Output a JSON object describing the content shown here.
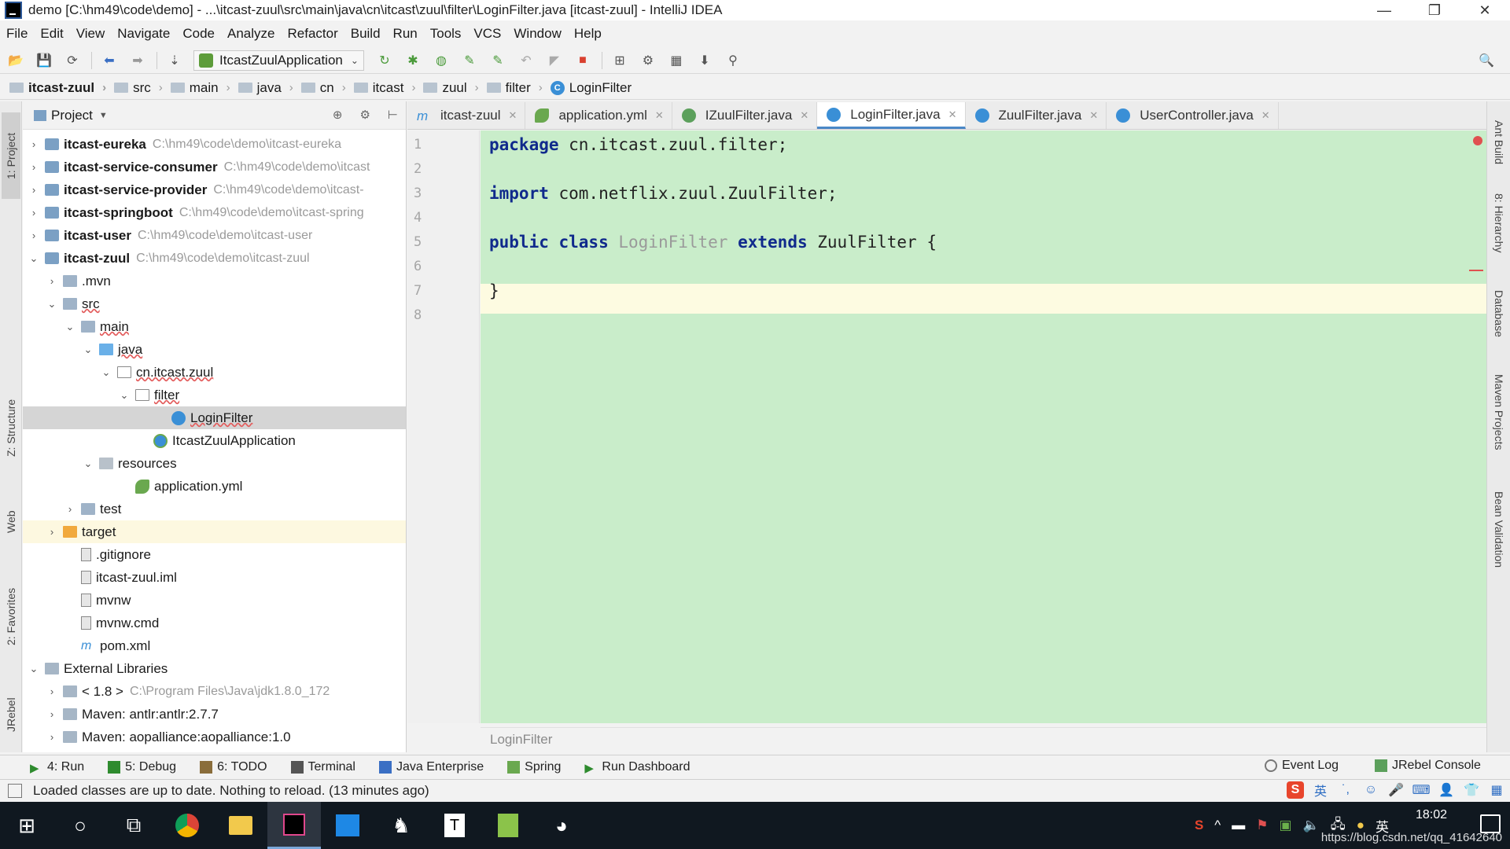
{
  "window": {
    "title": "demo [C:\\hm49\\code\\demo] - ...\\itcast-zuul\\src\\main\\java\\cn\\itcast\\zuul\\filter\\LoginFilter.java [itcast-zuul] - IntelliJ IDEA",
    "minimize": "—",
    "restore": "❐",
    "close": "✕"
  },
  "menu": [
    "File",
    "Edit",
    "View",
    "Navigate",
    "Code",
    "Analyze",
    "Refactor",
    "Build",
    "Run",
    "Tools",
    "VCS",
    "Window",
    "Help"
  ],
  "toolbar": {
    "run_config": "ItcastZuulApplication",
    "icons": [
      "open-icon",
      "save-icon",
      "sync-icon",
      "back-icon",
      "forward-icon",
      "build-icon"
    ],
    "run_icons": [
      "rerun-icon",
      "debug-icon",
      "coverage-icon",
      "profile-icon",
      "attach-icon",
      "reload-icon",
      "stop-icon",
      "stop-red-icon"
    ],
    "misc_icons": [
      "structure-icon",
      "settings-icon",
      "project-structure-icon",
      "sdk-icon",
      "jrebel-icon"
    ],
    "search_icon": "search-icon"
  },
  "breadcrumb": [
    "itcast-zuul",
    "src",
    "main",
    "java",
    "cn",
    "itcast",
    "zuul",
    "filter",
    "LoginFilter"
  ],
  "left_strip": {
    "project_tab": "1: Project",
    "structure_tab": "Z: Structure",
    "web_tab": "Web",
    "favorites_tab": "2: Favorites",
    "jrebel_tab": "JRebel"
  },
  "right_strip": {
    "ant_build": "Ant Build",
    "hierarchy": "8: Hierarchy",
    "database": "Database",
    "maven": "Maven Projects",
    "bean_validation": "Bean Validation"
  },
  "project_panel": {
    "title": "Project",
    "tree": [
      {
        "label": "itcast-eureka",
        "path": "C:\\hm49\\code\\demo\\itcast-eureka",
        "icon": "module",
        "arrow": "›",
        "indent": 0,
        "bold": true
      },
      {
        "label": "itcast-service-consumer",
        "path": "C:\\hm49\\code\\demo\\itcast",
        "icon": "module",
        "arrow": "›",
        "indent": 0,
        "bold": true
      },
      {
        "label": "itcast-service-provider",
        "path": "C:\\hm49\\code\\demo\\itcast-",
        "icon": "module",
        "arrow": "›",
        "indent": 0,
        "bold": true
      },
      {
        "label": "itcast-springboot",
        "path": "C:\\hm49\\code\\demo\\itcast-spring",
        "icon": "module",
        "arrow": "›",
        "indent": 0,
        "bold": true
      },
      {
        "label": "itcast-user",
        "path": "C:\\hm49\\code\\demo\\itcast-user",
        "icon": "module",
        "arrow": "›",
        "indent": 0,
        "bold": true
      },
      {
        "label": "itcast-zuul",
        "path": "C:\\hm49\\code\\demo\\itcast-zuul",
        "icon": "module",
        "arrow": "⌄",
        "indent": 0,
        "bold": true
      },
      {
        "label": ".mvn",
        "path": "",
        "icon": "folder",
        "arrow": "›",
        "indent": 1
      },
      {
        "label": "src",
        "path": "",
        "icon": "folder",
        "arrow": "⌄",
        "indent": 1,
        "red": true
      },
      {
        "label": "main",
        "path": "",
        "icon": "folder",
        "arrow": "⌄",
        "indent": 2,
        "red": true
      },
      {
        "label": "java",
        "path": "",
        "icon": "src-folder",
        "arrow": "⌄",
        "indent": 3,
        "red": true
      },
      {
        "label": "cn.itcast.zuul",
        "path": "",
        "icon": "pkg",
        "arrow": "⌄",
        "indent": 4,
        "red": true
      },
      {
        "label": "filter",
        "path": "",
        "icon": "pkg",
        "arrow": "⌄",
        "indent": 5,
        "red": true
      },
      {
        "label": "LoginFilter",
        "path": "",
        "icon": "class",
        "arrow": "",
        "indent": 7,
        "red": true,
        "selected": true
      },
      {
        "label": "ItcastZuulApplication",
        "path": "",
        "icon": "springclass",
        "arrow": "",
        "indent": 6
      },
      {
        "label": "resources",
        "path": "",
        "icon": "res-folder",
        "arrow": "⌄",
        "indent": 3
      },
      {
        "label": "application.yml",
        "path": "",
        "icon": "yml",
        "arrow": "",
        "indent": 5
      },
      {
        "label": "test",
        "path": "",
        "icon": "folder",
        "arrow": "›",
        "indent": 2
      },
      {
        "label": "target",
        "path": "",
        "icon": "target-folder",
        "arrow": "›",
        "indent": 1,
        "highlight": true
      },
      {
        "label": ".gitignore",
        "path": "",
        "icon": "file",
        "arrow": "",
        "indent": 2
      },
      {
        "label": "itcast-zuul.iml",
        "path": "",
        "icon": "file",
        "arrow": "",
        "indent": 2
      },
      {
        "label": "mvnw",
        "path": "",
        "icon": "file",
        "arrow": "",
        "indent": 2
      },
      {
        "label": "mvnw.cmd",
        "path": "",
        "icon": "file",
        "arrow": "",
        "indent": 2
      },
      {
        "label": "pom.xml",
        "path": "",
        "icon": "maven",
        "arrow": "",
        "indent": 2
      },
      {
        "label": "External Libraries",
        "path": "",
        "icon": "lib",
        "arrow": "⌄",
        "indent": 0
      },
      {
        "label": "< 1.8 >",
        "path": "C:\\Program Files\\Java\\jdk1.8.0_172",
        "icon": "lib",
        "arrow": "›",
        "indent": 1
      },
      {
        "label": "Maven: antlr:antlr:2.7.7",
        "path": "",
        "icon": "lib",
        "arrow": "›",
        "indent": 1
      },
      {
        "label": "Maven: aopalliance:aopalliance:1.0",
        "path": "",
        "icon": "lib",
        "arrow": "›",
        "indent": 1
      }
    ]
  },
  "editor": {
    "tabs": [
      {
        "label": "itcast-zuul",
        "icon": "m",
        "active": false
      },
      {
        "label": "application.yml",
        "icon": "y",
        "active": false
      },
      {
        "label": "IZuulFilter.java",
        "icon": "i",
        "active": false
      },
      {
        "label": "LoginFilter.java",
        "icon": "c",
        "active": true
      },
      {
        "label": "ZuulFilter.java",
        "icon": "c",
        "active": false
      },
      {
        "label": "UserController.java",
        "icon": "c",
        "active": false
      }
    ],
    "line_numbers": [
      "1",
      "2",
      "3",
      "4",
      "5",
      "6",
      "7",
      "8"
    ],
    "lines": [
      {
        "kw": "package",
        "rest": " cn.itcast.zuul.filter;"
      },
      {
        "kw": "",
        "rest": ""
      },
      {
        "kw": "import",
        "rest": " com.netflix.zuul.ZuulFilter;"
      },
      {
        "kw": "",
        "rest": ""
      },
      {
        "kw": "public class",
        "unused": "LoginFilter",
        "kw2": "extends",
        "rest": " ZuulFilter {"
      },
      {
        "kw": "",
        "rest": ""
      },
      {
        "kw": "",
        "rest": "}"
      },
      {
        "kw": "",
        "rest": ""
      }
    ],
    "breadcrumb": "LoginFilter"
  },
  "bottom_tools": {
    "left": [
      "4: Run",
      "5: Debug",
      "6: TODO",
      "Terminal",
      "Java Enterprise",
      "Spring",
      "Run Dashboard"
    ],
    "event_log": "Event Log",
    "jrebel_console": "JRebel Console"
  },
  "status": {
    "message": "Loaded classes are up to date. Nothing to reload. (13 minutes ago)"
  },
  "taskbar": {
    "icons": [
      "windows-start-icon",
      "search-circle-icon",
      "task-view-icon",
      "chrome-icon",
      "file-explorer-icon",
      "intellij-icon",
      "store-icon",
      "app-icon",
      "typora-icon",
      "notepad-icon",
      "network-app-icon"
    ],
    "clock": "18:02",
    "watermark": "https://blog.csdn.net/qq_41642640"
  }
}
